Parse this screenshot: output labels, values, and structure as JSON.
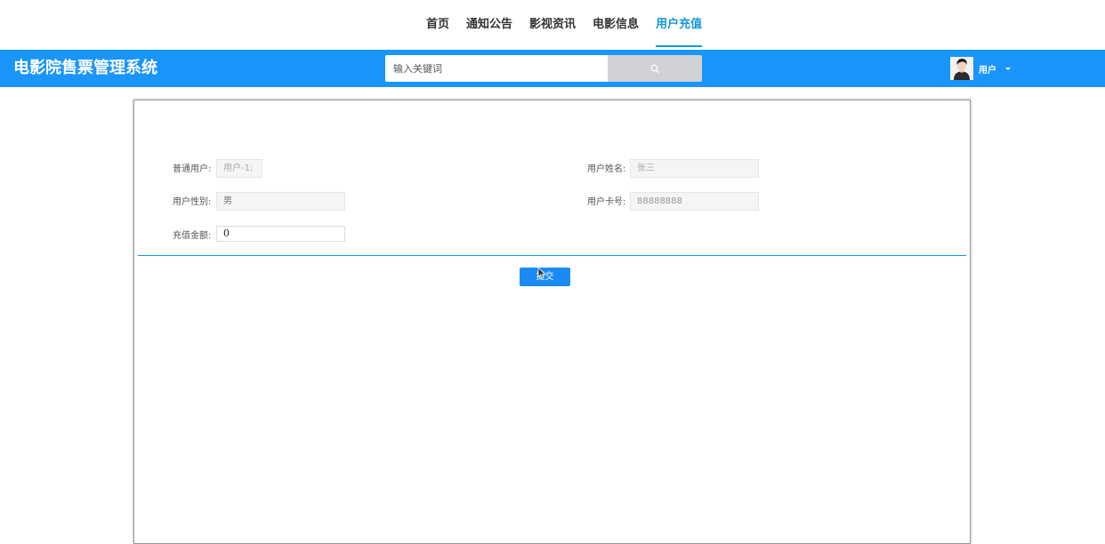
{
  "top_nav": {
    "items": [
      {
        "label": "首页",
        "active": false
      },
      {
        "label": "通知公告",
        "active": false
      },
      {
        "label": "影视资讯",
        "active": false
      },
      {
        "label": "电影信息",
        "active": false
      },
      {
        "label": "用户充值",
        "active": true
      }
    ]
  },
  "header": {
    "site_title": "电影院售票管理系统",
    "search": {
      "placeholder": "输入关键词",
      "value": "",
      "button_icon": "search-icon"
    },
    "user": {
      "label": "用户",
      "avatar": "user-avatar"
    }
  },
  "form": {
    "fields": [
      {
        "label": "普通用户:",
        "value": "用户-1;"
      },
      {
        "label": "用户姓名:",
        "value": "张三"
      },
      {
        "label": "用户性别:",
        "value": "男"
      },
      {
        "label": "用户卡号:",
        "value": "88888888"
      },
      {
        "label": "充值金额:",
        "value": "0"
      }
    ],
    "submit_label": "提交"
  },
  "colors": {
    "accent": "#1a95fb",
    "active_nav": "#1296db",
    "search_button": "#d0d2d6"
  }
}
